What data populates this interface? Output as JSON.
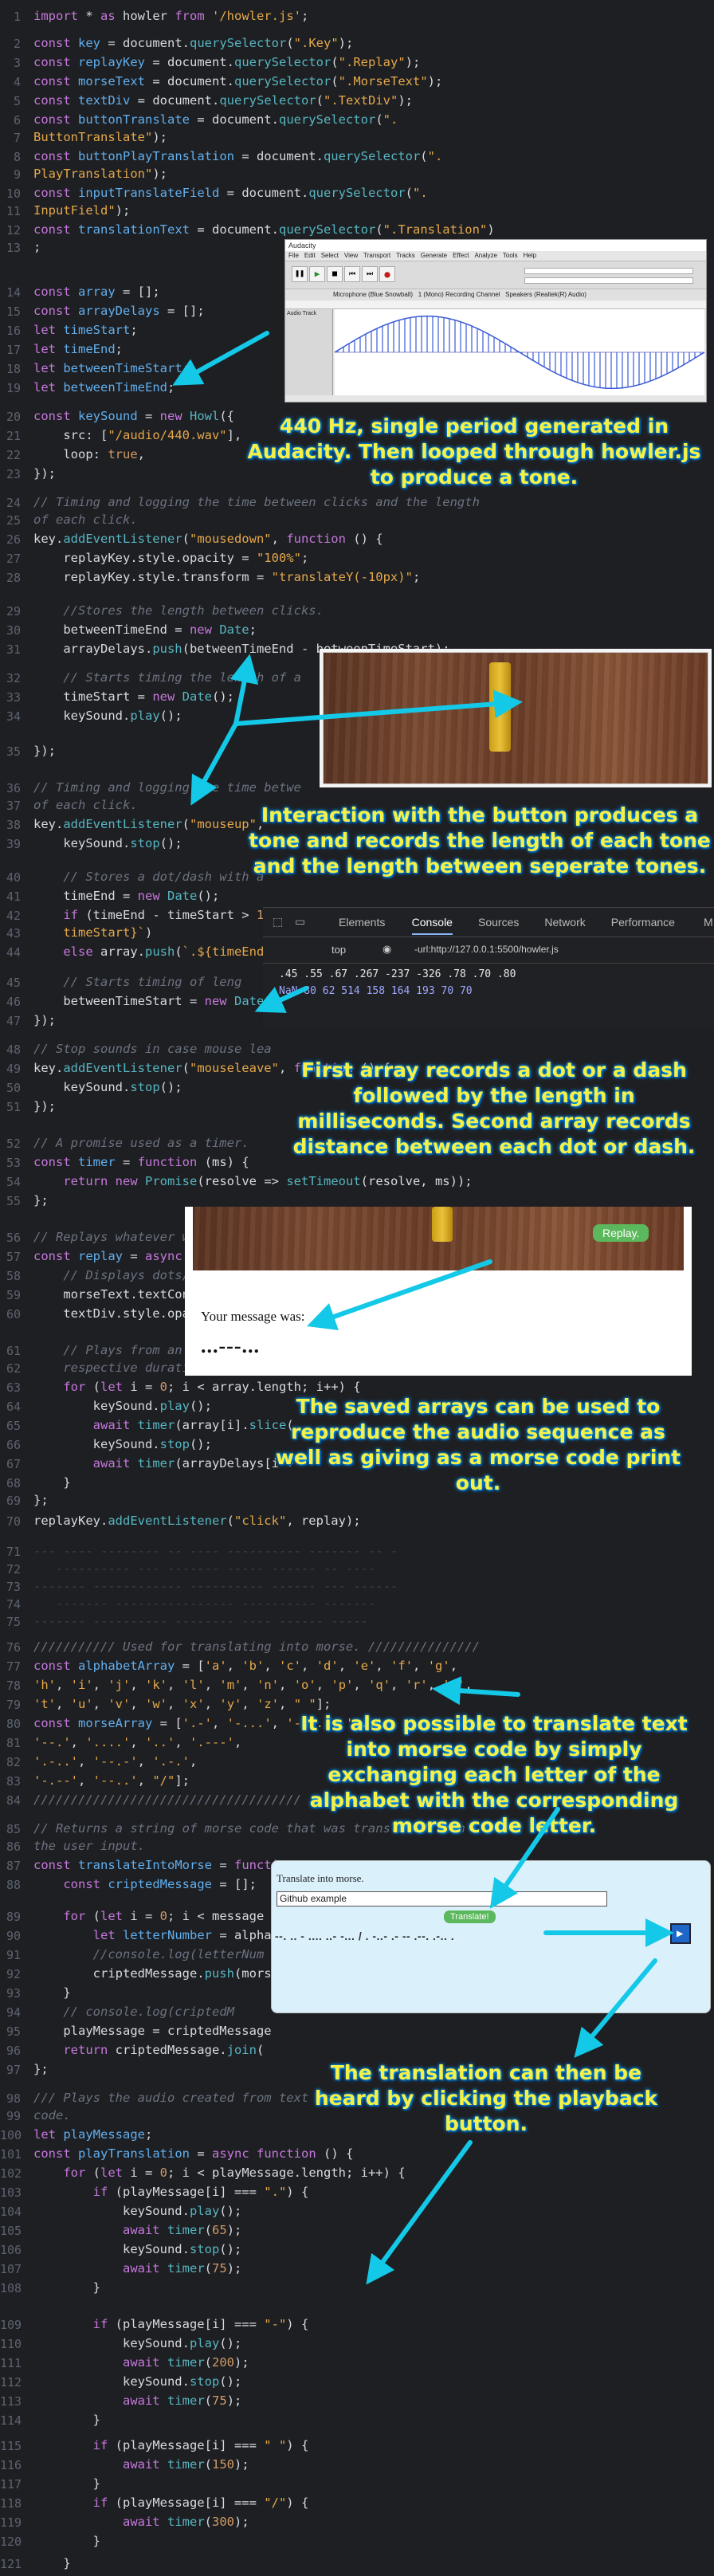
{
  "colors": {
    "background": "#1e1f22",
    "annotation_text": "#f6f046",
    "annotation_glow": "#00a8ff",
    "arrow": "#14c8e8",
    "keyword": "#c678dd",
    "string": "#e5a84b",
    "comment": "#6b7280",
    "replay_button": "#5cb85c"
  },
  "annotations": {
    "a1": "440 Hz, single period generated in Audacity. Then looped through howler.js to produce a tone.",
    "a2": "Interaction with the  button produces a tone and records the length of each tone and the length between seperate tones.",
    "a3": "First array records a dot or a dash followed by the length in milliseconds. Second array records distance between each dot or dash.",
    "a4": "The saved arrays can be used to reproduce the audio sequence as well as giving as a morse code print out.",
    "a5": "It is also possible to translate text into morse code by simply exchanging each letter of the alphabet with the corresponding morse code letter.",
    "a6": "The translation can then be heard by clicking the playback button."
  },
  "audacity": {
    "title": "Audacity",
    "menu": [
      "File",
      "Edit",
      "Select",
      "View",
      "Transport",
      "Tracks",
      "Generate",
      "Effect",
      "Analyze",
      "Tools",
      "Help"
    ],
    "device": "Microphone (Blue Snowball)",
    "channels": "1 (Mono) Recording Channel",
    "output": "Speakers (Realtek(R) Audio)",
    "track_name": "Audio Track"
  },
  "devtools": {
    "tabs": [
      "Elements",
      "Console",
      "Sources",
      "Network",
      "Performance",
      "M"
    ],
    "active_tab": "Console",
    "context": "top",
    "filter": "-url:http://127.0.0.1:5500/howler.js",
    "array_line": ".45 .55 .67 .267 -237 -326 .78 .70 .80",
    "delays_line": "NaN 80 62 514 158 164 193 70 70",
    "prompt": "›"
  },
  "replay": {
    "button": "Replay.",
    "message_label": "Your message was:",
    "message_value": "...---..."
  },
  "translate": {
    "label": "Translate into morse.",
    "input_value": "Github example",
    "button": "Translate!",
    "output": "--. .. - .... ..- -... / . -..- .- -- .--. .-.. ."
  }
}
